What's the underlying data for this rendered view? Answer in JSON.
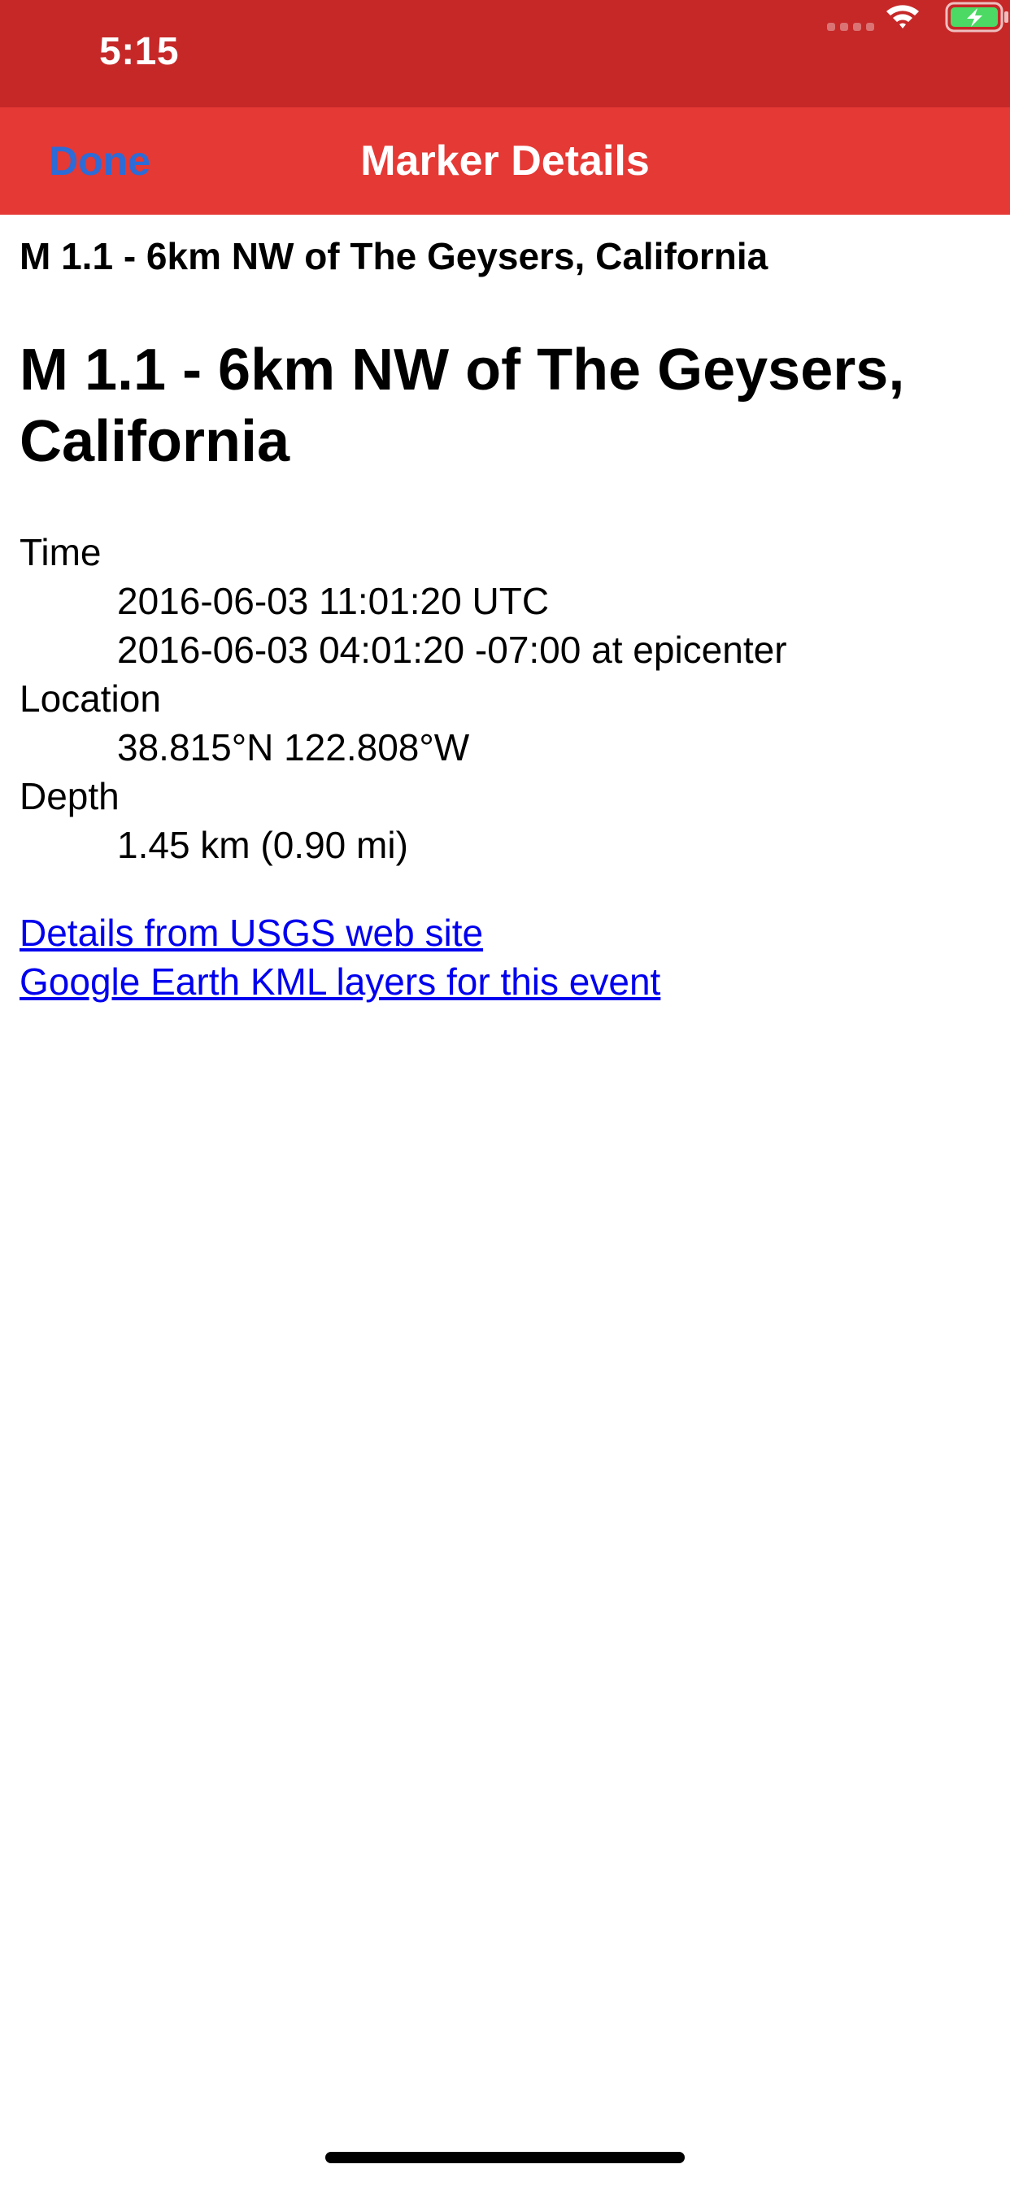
{
  "status_bar": {
    "time": "5:15",
    "icons": [
      "signal-icon",
      "wifi-icon",
      "battery-charging-icon"
    ]
  },
  "nav_bar": {
    "done_label": "Done",
    "title": "Marker Details"
  },
  "page": {
    "title": "M 1.1 - 6km NW of The Geysers, California",
    "heading": "M 1.1 - 6km NW of The Geysers, California",
    "time_label": "Time",
    "time_utc": "2016-06-03 11:01:20 UTC",
    "time_local": "2016-06-03 04:01:20 -07:00 at epicenter",
    "location_label": "Location",
    "location_value": "38.815°N 122.808°W",
    "depth_label": "Depth",
    "depth_value": "1.45 km (0.90 mi)",
    "links": {
      "usgs": "Details from USGS web site",
      "kml": "Google Earth KML layers for this event"
    }
  },
  "colors": {
    "status_bar": "#c62828",
    "nav_bar": "#e53935",
    "done_button": "#2d6bd6",
    "link": "#0000ee"
  }
}
